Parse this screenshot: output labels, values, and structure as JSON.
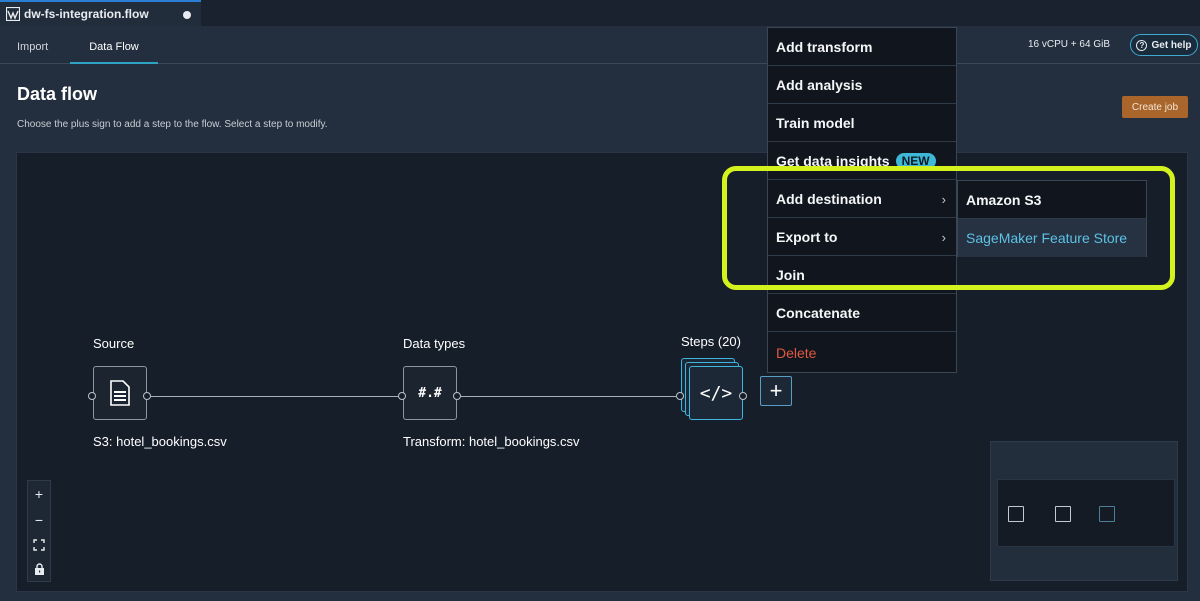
{
  "file_tab": {
    "name": "dw-fs-integration.flow"
  },
  "nav": {
    "import": "Import",
    "data_flow": "Data Flow"
  },
  "header": {
    "resources": "16 vCPU + 64 GiB",
    "help": "Get help",
    "title": "Data flow",
    "subtitle": "Choose the plus sign to add a step to the flow. Select a step to modify.",
    "create_job": "Create job"
  },
  "nodes": {
    "source": {
      "label": "Source",
      "caption": "S3: hotel_bookings.csv"
    },
    "data_types": {
      "label": "Data types",
      "glyph": "#.#",
      "caption": "Transform: hotel_bookings.csv"
    },
    "steps": {
      "label": "Steps (20)",
      "glyph": "</>"
    }
  },
  "add_step": "+",
  "zoom": {
    "in": "+",
    "out": "−"
  },
  "menu": {
    "items": [
      {
        "label": "Add transform"
      },
      {
        "label": "Add analysis"
      },
      {
        "label": "Train model"
      },
      {
        "label": "Get data insights",
        "badge": "NEW"
      },
      {
        "label": "Add destination",
        "chevron": "›"
      },
      {
        "label": "Export to",
        "chevron": "›"
      },
      {
        "label": "Join"
      },
      {
        "label": "Concatenate"
      },
      {
        "label": "Delete"
      }
    ]
  },
  "submenu": {
    "items": [
      {
        "label": "Amazon S3"
      },
      {
        "label": "SageMaker Feature Store"
      }
    ]
  },
  "colors": {
    "accent": "#3fb6e0",
    "highlight": "#d4f21e",
    "create_job": "#a9652a",
    "delete": "#e0583f"
  }
}
